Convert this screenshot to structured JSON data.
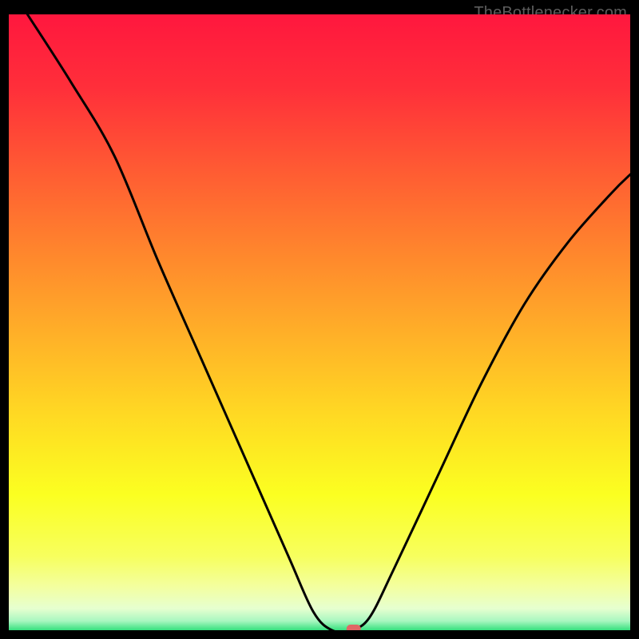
{
  "watermark": "TheBottlenecker.com",
  "chart_data": {
    "type": "line",
    "title": "",
    "xlabel": "",
    "ylabel": "",
    "xlim": [
      0,
      100
    ],
    "ylim": [
      0,
      100
    ],
    "x": [
      3,
      10,
      17,
      24,
      31,
      38,
      45,
      49,
      52,
      55,
      58,
      62,
      69,
      76,
      83,
      90,
      97,
      100
    ],
    "y": [
      100,
      89,
      77,
      60,
      44,
      28,
      12,
      3,
      0,
      0,
      2,
      10,
      25,
      40,
      53,
      63,
      71,
      74
    ],
    "marker": {
      "x": 55.5,
      "y": 0
    },
    "gradient_stops": [
      {
        "offset": 0.0,
        "color": "#ff173e"
      },
      {
        "offset": 0.12,
        "color": "#ff2f3a"
      },
      {
        "offset": 0.25,
        "color": "#ff5a33"
      },
      {
        "offset": 0.38,
        "color": "#ff842d"
      },
      {
        "offset": 0.52,
        "color": "#ffb028"
      },
      {
        "offset": 0.65,
        "color": "#ffd923"
      },
      {
        "offset": 0.78,
        "color": "#fbff21"
      },
      {
        "offset": 0.88,
        "color": "#f7ff5e"
      },
      {
        "offset": 0.93,
        "color": "#f3ffa0"
      },
      {
        "offset": 0.965,
        "color": "#e6ffd0"
      },
      {
        "offset": 0.985,
        "color": "#a8f7c0"
      },
      {
        "offset": 1.0,
        "color": "#36e07e"
      }
    ]
  }
}
